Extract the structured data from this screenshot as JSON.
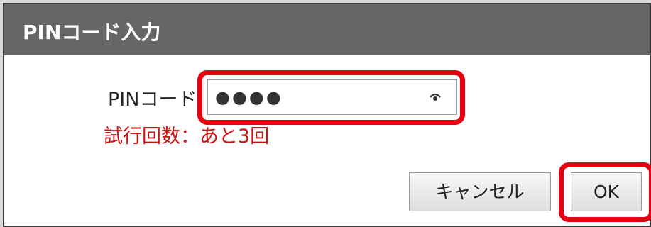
{
  "dialog": {
    "title": "PINコード入力",
    "pin_label": "PINコード",
    "pin_value": "●●●●",
    "attempts_text": "試行回数：あと3回",
    "cancel_label": "キャンセル",
    "ok_label": "OK"
  },
  "icons": {
    "reveal": "eye-icon"
  },
  "colors": {
    "titlebar": "#666666",
    "highlight": "#e60012",
    "warning_text": "#cc1111"
  }
}
